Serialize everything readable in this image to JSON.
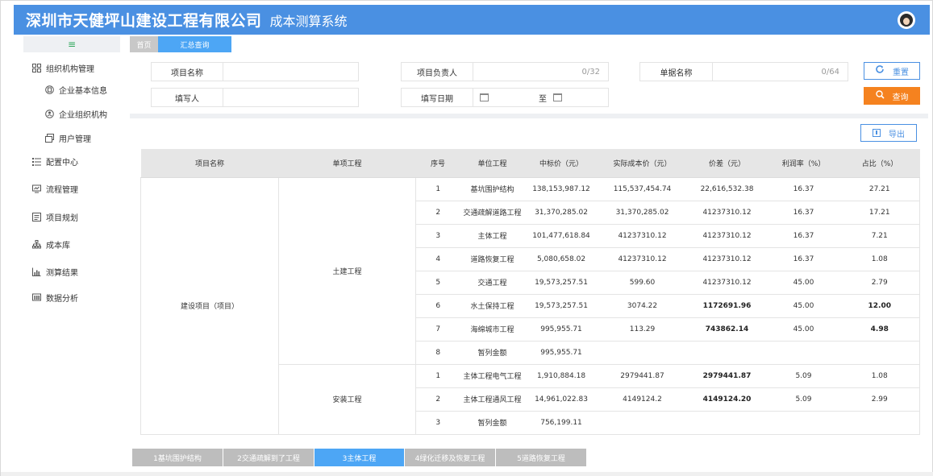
{
  "header": {
    "company": "深圳市天健坪山建设工程有限公司",
    "system": "成本测算系统"
  },
  "sidebar": {
    "toggle_glyph": "≡",
    "items": [
      {
        "label": "组织机构管理",
        "icon": "grid-icon"
      },
      {
        "label": "企业基本信息",
        "icon": "info-icon"
      },
      {
        "label": "企业组织机构",
        "icon": "org-icon"
      },
      {
        "label": "用户管理",
        "icon": "user-icon"
      },
      {
        "label": "配置中心",
        "icon": "list-icon"
      },
      {
        "label": "流程管理",
        "icon": "flow-icon"
      },
      {
        "label": "项目规划",
        "icon": "plan-icon"
      },
      {
        "label": "成本库",
        "icon": "tree-icon"
      },
      {
        "label": "测算结果",
        "icon": "chart-icon"
      },
      {
        "label": "数据分析",
        "icon": "analysis-icon"
      }
    ]
  },
  "tabs": {
    "home": "首页",
    "active": "汇总查询"
  },
  "filters": {
    "project_name_label": "项目名称",
    "project_name_value": "",
    "owner_label": "项目负责人",
    "owner_counter": "0/32",
    "doc_name_label": "单据名称",
    "doc_name_counter": "0/64",
    "filler_label": "填写人",
    "filler_value": "",
    "date_label": "填写日期",
    "date_to": "至"
  },
  "buttons": {
    "reset": "重置",
    "query": "查询",
    "export": "导出"
  },
  "table": {
    "headers": [
      "项目名称",
      "单项工程",
      "序号",
      "单位工程",
      "中标价（元）",
      "实际成本价（元）",
      "价差（元）",
      "利润率（%）",
      "占比（%）"
    ],
    "project": "建设项目（项目）",
    "groups": [
      {
        "name": "土建工程",
        "rows": [
          {
            "no": "1",
            "unit": "基坑围护结构",
            "bid": "138,153,987.12",
            "actual": "115,537,454.74",
            "diff": "22,616,532.38",
            "rate": "16.37",
            "share": "27.21"
          },
          {
            "no": "2",
            "unit": "交通疏解道路工程",
            "bid": "31,370,285.02",
            "actual": "31,370,285.02",
            "diff": "41237310.12",
            "rate": "16.37",
            "share": "17.21"
          },
          {
            "no": "3",
            "unit": "主体工程",
            "bid": "101,477,618.84",
            "actual": "41237310.12",
            "diff": "41237310.12",
            "rate": "16.37",
            "share": "7.21"
          },
          {
            "no": "4",
            "unit": "道路恢复工程",
            "bid": "5,080,658.02",
            "actual": "41237310.12",
            "diff": "41237310.12",
            "rate": "16.37",
            "share": "1.08"
          },
          {
            "no": "5",
            "unit": "交通工程",
            "bid": "19,573,257.51",
            "actual": "599.60",
            "diff": "41237310.12",
            "rate": "45.00",
            "share": "2.79"
          },
          {
            "no": "6",
            "unit": "水土保持工程",
            "bid": "19,573,257.51",
            "actual": "3074.22",
            "diff": "1172691.96",
            "rate": "45.00",
            "share": "12.00"
          },
          {
            "no": "7",
            "unit": "海绵城市工程",
            "bid": "995,955.71",
            "actual": "113.29",
            "diff": "743862.14",
            "rate": "45.00",
            "share": "4.98"
          },
          {
            "no": "8",
            "unit": "暂列金额",
            "bid": "995,955.71",
            "actual": "",
            "diff": "",
            "rate": "",
            "share": ""
          }
        ]
      },
      {
        "name": "安装工程",
        "rows": [
          {
            "no": "1",
            "unit": "主体工程电气工程",
            "bid": "1,910,884.18",
            "actual": "2979441.87",
            "diff": "2979441.87",
            "rate": "5.09",
            "share": "1.08"
          },
          {
            "no": "2",
            "unit": "主体工程通风工程",
            "bid": "14,961,022.83",
            "actual": "4149124.2",
            "diff": "4149124.20",
            "rate": "5.09",
            "share": "2.99"
          },
          {
            "no": "3",
            "unit": "暂列金额",
            "bid": "756,199.11",
            "actual": "",
            "diff": "",
            "rate": "",
            "share": ""
          }
        ]
      }
    ]
  },
  "pager": [
    "1基坑围护结构",
    "2交通疏解到了工程",
    "3主体工程",
    "4绿化迁移及恢复工程",
    "5道路恢复工程"
  ],
  "pager_active": 2,
  "colors": {
    "header_bg": "#4a90e2",
    "tab_active": "#4da6f5",
    "query_btn": "#f5821f"
  }
}
